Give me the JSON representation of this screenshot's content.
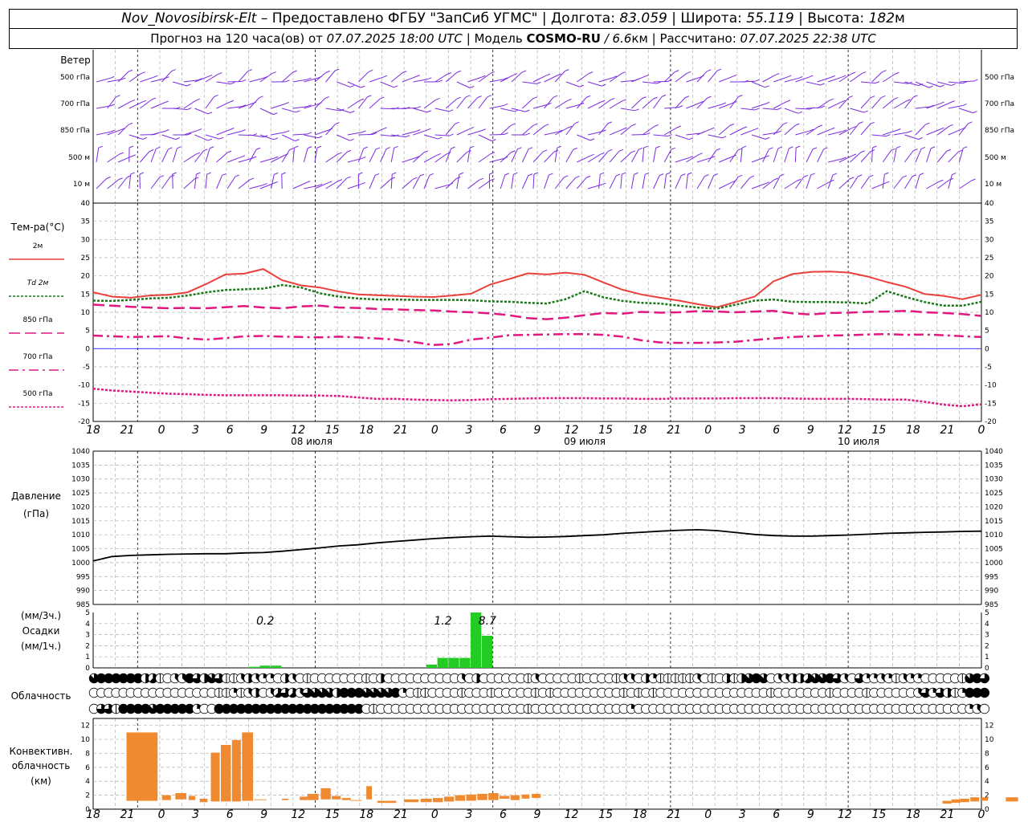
{
  "header": {
    "station": "Nov_Novosibirsk-Elt",
    "provided": "– Предоставлено ФГБУ \"ЗапСиб УГМС\"",
    "lon_label": "Долгота:",
    "lon_value": "83.059",
    "lat_label": "Широта:",
    "lat_value": "55.119",
    "alt_label": "Высота:",
    "alt_value": "182",
    "alt_unit": "м",
    "sep": "|",
    "forecast_label": "Прогноз на 120 часа(ов) от",
    "forecast_time": "07.07.2025 18:00 UTC",
    "model_label": "Модель",
    "model_name": "COSMO-RU",
    "model_res": "/ 6.6",
    "model_res_unit": "км",
    "calc_label": "Рассчитано:",
    "calc_time": "07.07.2025 22:38 UTC"
  },
  "labels": {
    "wind": "Ветер",
    "wind_levels": [
      "500 гПа",
      "700 гПа",
      "850 гПа",
      "500 м",
      "10 м"
    ],
    "temp": "Тем-ра(°C)",
    "temp_legend": [
      "2м",
      "Td 2м",
      "850 гПа",
      "700 гПа",
      "500 гПа"
    ],
    "pressure": "Давление",
    "pressure_unit": "(гПа)",
    "precip_unit1": "(мм/3ч.)",
    "precip": "Осадки",
    "precip_unit2": "(мм/1ч.)",
    "cloud": "Облачность",
    "conv1": "Конвективн.",
    "conv2": "облачность",
    "conv3": "(км)"
  },
  "colors": {
    "t2m": "#e8403a",
    "td2m": "#1a7a1a",
    "t850": "#e01880",
    "t700": "#e01880",
    "t500": "#e01880",
    "wind": "#7a2be0",
    "precip": "#22cc22",
    "conv": "#f08a30",
    "zero": "#2020ff"
  },
  "chart_data": {
    "type": "meteogram",
    "x_hours_tick_labels": [
      "18",
      "21",
      "0",
      "3",
      "6",
      "9",
      "12",
      "15",
      "18",
      "21",
      "0",
      "3",
      "6",
      "9",
      "12",
      "15",
      "18",
      "21",
      "0",
      "3",
      "6",
      "9",
      "12",
      "15",
      "18",
      "21",
      "0"
    ],
    "day_labels": [
      "08 июля",
      "09 июля",
      "10 июля"
    ],
    "temperature": {
      "ylim": [
        -20,
        40
      ],
      "ticks": [
        -20,
        -15,
        -10,
        -5,
        0,
        5,
        10,
        15,
        20,
        25,
        30,
        35,
        40
      ],
      "series": [
        {
          "key": "t2m",
          "values": [
            15.5,
            14.3,
            14.0,
            14.6,
            14.8,
            15.5,
            17.8,
            20.4,
            20.6,
            21.9,
            18.8,
            17.4,
            16.8,
            15.7,
            14.9,
            14.7,
            14.5,
            14.3,
            14.2,
            14.6,
            15.1,
            17.6,
            19.1,
            20.7,
            20.4,
            20.9,
            20.3,
            18.2,
            16.2,
            14.9,
            14.0,
            13.2,
            12.2,
            11.4,
            12.8,
            14.3,
            18.5,
            20.5,
            21.1,
            21.2,
            20.9,
            19.8,
            18.3,
            17.0,
            15.0,
            14.5,
            13.6,
            14.8
          ]
        },
        {
          "key": "td2m",
          "values": [
            13.2,
            13.1,
            13.4,
            13.8,
            14.0,
            14.6,
            15.5,
            16.1,
            16.3,
            16.5,
            17.5,
            16.8,
            15.2,
            14.3,
            13.8,
            13.5,
            13.5,
            13.4,
            13.4,
            13.4,
            13.3,
            13.0,
            12.9,
            12.6,
            12.4,
            13.6,
            15.8,
            14.1,
            13.1,
            12.6,
            12.4,
            11.8,
            11.3,
            11.0,
            12.1,
            13.2,
            13.5,
            12.9,
            12.8,
            12.8,
            12.7,
            12.4,
            15.8,
            14.2,
            12.8,
            11.8,
            11.8,
            12.9
          ]
        },
        {
          "key": "t850",
          "values": [
            12.1,
            11.8,
            11.5,
            11.3,
            11.1,
            11.2,
            11.1,
            11.4,
            11.7,
            11.3,
            11.1,
            11.6,
            11.8,
            11.3,
            11.2,
            10.9,
            10.8,
            10.6,
            10.5,
            10.2,
            10.0,
            9.7,
            9.2,
            8.4,
            8.1,
            8.5,
            9.2,
            9.8,
            9.6,
            10.1,
            9.9,
            10.0,
            10.3,
            10.2,
            10.0,
            10.2,
            10.4,
            9.7,
            9.4,
            9.8,
            9.9,
            10.1,
            10.2,
            10.4,
            10.0,
            9.8,
            9.5,
            9.0
          ]
        },
        {
          "key": "t700",
          "values": [
            3.6,
            3.4,
            3.2,
            3.3,
            3.4,
            2.8,
            2.5,
            2.9,
            3.4,
            3.5,
            3.3,
            3.2,
            3.1,
            3.3,
            3.1,
            2.8,
            2.5,
            1.8,
            1.0,
            1.3,
            2.5,
            3.0,
            3.7,
            3.8,
            3.9,
            4.0,
            4.0,
            3.8,
            3.3,
            2.3,
            1.7,
            1.6,
            1.6,
            1.7,
            1.9,
            2.4,
            2.8,
            3.2,
            3.4,
            3.6,
            3.7,
            3.9,
            4.0,
            3.8,
            3.9,
            3.7,
            3.4,
            3.2
          ]
        },
        {
          "key": "t500",
          "values": [
            -11.0,
            -11.5,
            -11.8,
            -12.1,
            -12.4,
            -12.5,
            -12.7,
            -12.8,
            -12.8,
            -12.8,
            -12.8,
            -12.9,
            -12.9,
            -13.0,
            -13.4,
            -13.8,
            -13.8,
            -14.0,
            -14.1,
            -14.2,
            -14.1,
            -13.9,
            -13.8,
            -13.7,
            -13.6,
            -13.6,
            -13.6,
            -13.7,
            -13.7,
            -13.8,
            -13.8,
            -13.7,
            -13.7,
            -13.7,
            -13.6,
            -13.6,
            -13.6,
            -13.7,
            -13.8,
            -13.8,
            -13.8,
            -13.9,
            -14.0,
            -14.0,
            -14.6,
            -15.4,
            -15.8,
            -15.3
          ]
        }
      ]
    },
    "pressure": {
      "ylim": [
        985,
        1040
      ],
      "ticks": [
        985,
        990,
        995,
        1000,
        1005,
        1010,
        1015,
        1020,
        1025,
        1030,
        1035,
        1040
      ],
      "values": [
        1000.6,
        1002.2,
        1002.6,
        1002.8,
        1003.0,
        1003.1,
        1003.2,
        1003.2,
        1003.5,
        1003.6,
        1004.1,
        1004.7,
        1005.3,
        1006.0,
        1006.4,
        1007.1,
        1007.6,
        1008.1,
        1008.6,
        1009.0,
        1009.3,
        1009.5,
        1009.3,
        1009.1,
        1009.2,
        1009.4,
        1009.7,
        1010.0,
        1010.5,
        1010.9,
        1011.3,
        1011.6,
        1011.8,
        1011.5,
        1010.8,
        1010.1,
        1009.7,
        1009.5,
        1009.5,
        1009.7,
        1009.9,
        1010.2,
        1010.5,
        1010.7,
        1010.9,
        1011.0,
        1011.2,
        1011.3
      ]
    },
    "precipitation": {
      "ylim": [
        0,
        5
      ],
      "ticks": [
        0,
        1,
        2,
        3,
        4,
        5
      ],
      "bars": [
        0,
        0,
        0,
        0,
        0,
        0,
        0,
        0,
        0,
        0,
        0,
        0,
        0,
        0,
        0.1,
        0.2,
        0.2,
        0,
        0,
        0,
        0,
        0,
        0,
        0,
        0,
        0,
        0,
        0,
        0,
        0,
        0.3,
        0.9,
        0.9,
        0.9,
        5.0,
        2.9,
        0,
        0,
        0,
        0,
        0,
        0,
        0,
        0,
        0,
        0,
        0,
        0
      ],
      "annotations": [
        {
          "text": "0.2",
          "at": 15.5
        },
        {
          "text": "1.2",
          "at": 31.5
        },
        {
          "text": "8.7",
          "at": 35.5
        }
      ]
    },
    "cloud_cover": {
      "note": "values in oktas (0..8) for upper, middle, lower rows",
      "rows": [
        [
          7,
          8,
          8,
          8,
          8,
          8,
          8,
          4,
          5,
          1,
          0,
          3,
          3,
          8,
          6,
          4,
          7,
          6,
          1,
          1,
          3,
          4,
          3,
          2,
          2,
          0,
          4,
          3,
          0,
          1,
          0,
          0,
          0,
          0,
          0,
          0,
          0,
          1,
          0,
          4,
          0,
          0,
          0,
          0,
          0,
          0,
          0,
          0,
          0,
          0,
          3,
          0,
          4,
          0,
          0,
          0,
          0,
          0,
          0,
          1,
          3,
          0,
          0,
          0,
          0,
          0,
          1,
          0,
          0,
          0,
          0,
          1,
          3,
          3,
          0,
          4,
          2,
          1,
          1,
          1,
          1,
          1,
          3,
          0,
          1,
          0,
          4,
          1,
          4,
          7,
          8,
          7,
          0,
          3,
          3,
          4,
          4,
          5,
          7,
          7,
          8,
          6,
          3,
          0,
          6,
          2,
          2,
          3,
          2,
          1,
          3,
          2,
          2,
          0,
          0,
          0,
          0,
          0,
          1,
          7,
          8,
          6
        ],
        [
          0,
          0,
          0,
          0,
          0,
          0,
          0,
          0,
          0,
          0,
          0,
          0,
          0,
          0,
          0,
          0,
          0,
          1,
          1,
          2,
          1,
          3,
          4,
          0,
          3,
          5,
          6,
          5,
          3,
          6,
          7,
          7,
          7,
          4,
          8,
          8,
          8,
          7,
          7,
          7,
          7,
          8,
          2,
          0,
          1,
          1,
          0,
          0,
          0,
          0,
          1,
          0,
          0,
          0,
          1,
          0,
          0,
          0,
          0,
          0,
          1,
          0,
          1,
          0,
          0,
          0,
          0,
          0,
          0,
          0,
          0,
          0,
          1,
          0,
          1,
          0,
          1,
          0,
          0,
          0,
          0,
          0,
          0,
          0,
          0,
          0,
          0,
          0,
          0,
          0,
          0,
          0,
          1,
          0,
          0,
          0,
          0,
          0,
          0,
          0,
          1,
          0,
          0,
          0,
          0,
          1,
          0,
          0,
          0,
          0,
          0,
          0,
          3,
          6,
          2,
          6,
          4,
          1,
          2,
          8,
          8,
          8
        ],
        [
          0,
          6,
          6,
          1,
          8,
          8,
          8,
          8,
          7,
          8,
          8,
          8,
          8,
          8,
          2,
          0,
          0,
          8,
          8,
          8,
          8,
          8,
          8,
          8,
          8,
          8,
          8,
          8,
          8,
          8,
          8,
          8,
          8,
          8,
          8,
          8,
          8,
          0,
          1,
          0,
          0,
          0,
          0,
          0,
          0,
          0,
          0,
          0,
          0,
          0,
          0,
          0,
          0,
          0,
          0,
          0,
          0,
          0,
          0,
          1,
          0,
          0,
          0,
          0,
          0,
          0,
          0,
          0,
          0,
          0,
          0,
          0,
          0,
          2,
          0,
          0,
          0,
          0,
          0,
          0,
          0,
          0,
          0,
          0,
          0,
          0,
          0,
          0,
          0,
          0,
          0,
          0,
          0,
          0,
          0,
          0,
          0,
          0,
          0,
          0,
          0,
          0,
          0,
          0,
          0,
          0,
          0,
          0,
          0,
          0,
          0,
          0,
          0,
          0,
          0,
          0,
          0,
          0,
          0,
          2,
          3,
          0
        ]
      ]
    },
    "convective_cloud": {
      "ylim": [
        0,
        13
      ],
      "ticks": [
        0,
        2,
        4,
        6,
        8,
        10,
        12
      ],
      "bars": [
        {
          "from": 3,
          "to": 5.8,
          "base": 1.2,
          "top": 11.0
        },
        {
          "from": 6.2,
          "to": 7.0,
          "base": 1.3,
          "top": 2.0
        },
        {
          "from": 7.4,
          "to": 8.4,
          "base": 1.4,
          "top": 2.3
        },
        {
          "from": 8.6,
          "to": 9.2,
          "base": 1.3,
          "top": 1.9
        },
        {
          "from": 9.6,
          "to": 10.3,
          "base": 1.0,
          "top": 1.5
        },
        {
          "from": 10.6,
          "to": 11.4,
          "base": 1.1,
          "top": 8.1
        },
        {
          "from": 11.5,
          "to": 12.4,
          "base": 1.1,
          "top": 9.2
        },
        {
          "from": 12.5,
          "to": 13.3,
          "base": 1.1,
          "top": 9.9
        },
        {
          "from": 13.4,
          "to": 14.4,
          "base": 1.2,
          "top": 11.0
        },
        {
          "from": 14.5,
          "to": 15.6,
          "base": 1.3,
          "top": 1.4
        },
        {
          "from": 17.0,
          "to": 17.6,
          "base": 1.3,
          "top": 1.5
        },
        {
          "from": 18.6,
          "to": 19.3,
          "base": 1.3,
          "top": 1.8
        },
        {
          "from": 19.3,
          "to": 20.3,
          "base": 1.3,
          "top": 2.2
        },
        {
          "from": 20.5,
          "to": 21.4,
          "base": 1.4,
          "top": 3.0
        },
        {
          "from": 21.5,
          "to": 22.3,
          "base": 1.4,
          "top": 1.9
        },
        {
          "from": 22.4,
          "to": 23.2,
          "base": 1.3,
          "top": 1.6
        },
        {
          "from": 23.2,
          "to": 24.2,
          "base": 1.2,
          "top": 1.3
        },
        {
          "from": 24.6,
          "to": 25.1,
          "base": 1.4,
          "top": 3.3
        },
        {
          "from": 25.6,
          "to": 27.3,
          "base": 0.9,
          "top": 1.2
        },
        {
          "from": 28.0,
          "to": 29.3,
          "base": 1.0,
          "top": 1.4
        },
        {
          "from": 29.5,
          "to": 30.5,
          "base": 1.0,
          "top": 1.5
        },
        {
          "from": 30.6,
          "to": 31.5,
          "base": 1.0,
          "top": 1.6
        },
        {
          "from": 31.6,
          "to": 32.5,
          "base": 1.1,
          "top": 1.8
        },
        {
          "from": 32.6,
          "to": 33.5,
          "base": 1.2,
          "top": 2.0
        },
        {
          "from": 33.6,
          "to": 34.5,
          "base": 1.2,
          "top": 2.1
        },
        {
          "from": 34.6,
          "to": 35.5,
          "base": 1.3,
          "top": 2.2
        },
        {
          "from": 35.6,
          "to": 36.5,
          "base": 1.3,
          "top": 2.3
        },
        {
          "from": 36.6,
          "to": 37.5,
          "base": 1.5,
          "top": 1.9
        },
        {
          "from": 37.6,
          "to": 38.4,
          "base": 1.3,
          "top": 2.0
        },
        {
          "from": 38.6,
          "to": 39.3,
          "base": 1.5,
          "top": 2.1
        },
        {
          "from": 39.5,
          "to": 40.3,
          "base": 1.6,
          "top": 2.2
        },
        {
          "from": 76.5,
          "to": 77.3,
          "base": 0.8,
          "top": 1.2
        },
        {
          "from": 77.3,
          "to": 78.1,
          "base": 0.9,
          "top": 1.4
        },
        {
          "from": 78.1,
          "to": 78.9,
          "base": 1.0,
          "top": 1.5
        },
        {
          "from": 79.0,
          "to": 79.8,
          "base": 1.1,
          "top": 1.7
        },
        {
          "from": 80.0,
          "to": 80.6,
          "base": 1.2,
          "top": 1.7
        },
        {
          "from": 82.2,
          "to": 83.3,
          "base": 1.1,
          "top": 1.7
        }
      ]
    },
    "wind": {
      "levels": [
        "500 гПа",
        "700 гПа",
        "850 гПа",
        "500 м",
        "10 м"
      ]
    }
  }
}
